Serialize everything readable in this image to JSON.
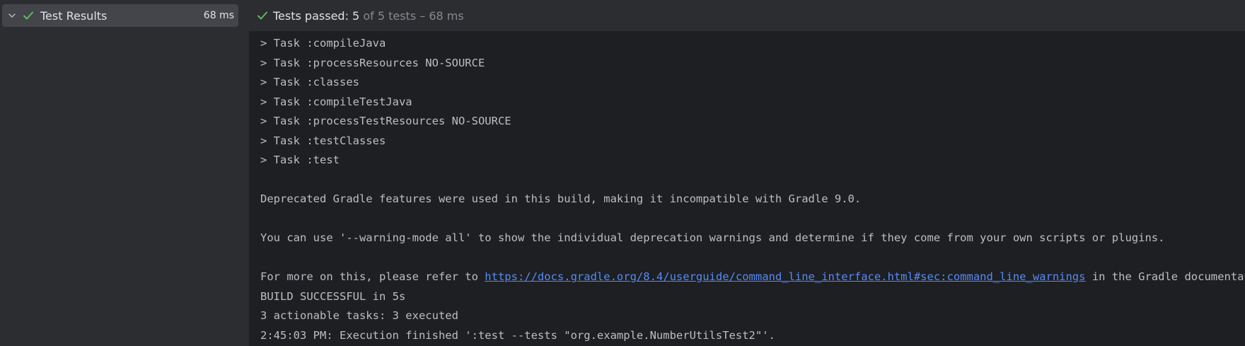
{
  "tree": {
    "root_label": "Test Results",
    "root_time": "68 ms"
  },
  "status": {
    "prefix": "Tests passed: ",
    "passed": "5",
    "suffix": " of 5 tests – 68 ms"
  },
  "console": {
    "lines": [
      "> Task :compileJava",
      "> Task :processResources NO-SOURCE",
      "> Task :classes",
      "> Task :compileTestJava",
      "> Task :processTestResources NO-SOURCE",
      "> Task :testClasses",
      "> Task :test",
      "",
      "Deprecated Gradle features were used in this build, making it incompatible with Gradle 9.0.",
      "",
      "You can use '--warning-mode all' to show the individual deprecation warnings and determine if they come from your own scripts or plugins.",
      ""
    ],
    "more_prefix": "For more on this, please refer to ",
    "more_link": "https://docs.gradle.org/8.4/userguide/command_line_interface.html#sec:command_line_warnings",
    "more_suffix": " in the Gradle documentation.",
    "tail_lines": [
      "BUILD SUCCESSFUL in 5s",
      "3 actionable tasks: 3 executed",
      "2:45:03 PM: Execution finished ':test --tests \"org.example.NumberUtilsTest2\"'."
    ]
  },
  "colors": {
    "success": "#5fb865",
    "link": "#548af7"
  },
  "icons": {
    "chevron": "chevron-down-icon",
    "check": "check-icon"
  }
}
